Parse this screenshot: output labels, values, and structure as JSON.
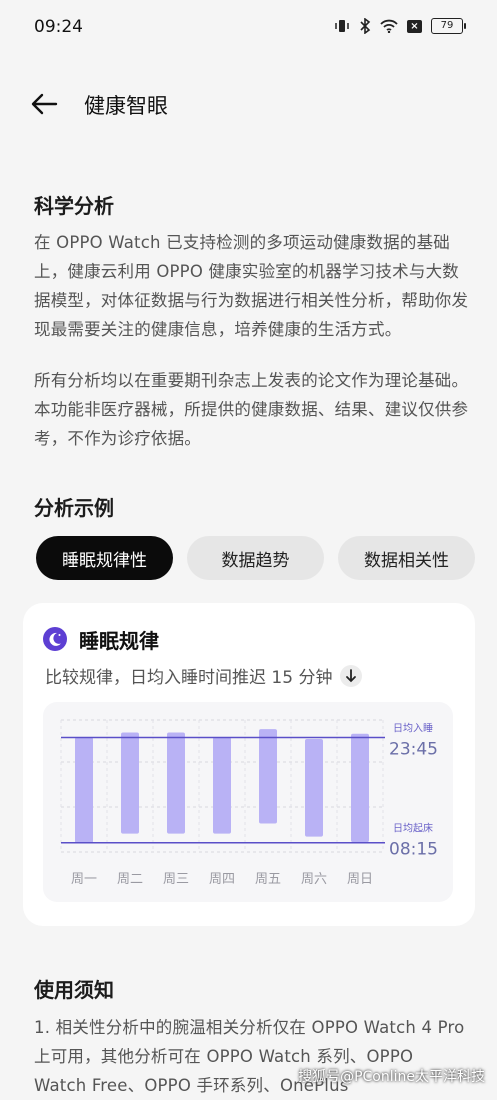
{
  "status_bar": {
    "time": "09:24",
    "battery": "79",
    "icons": [
      "vibrate-icon",
      "bluetooth-icon",
      "wifi-icon",
      "sim-x-icon",
      "battery-icon"
    ]
  },
  "header": {
    "title": "健康智眼",
    "back_icon": "arrow-left-icon"
  },
  "science": {
    "title": "科学分析",
    "p1": "在 OPPO Watch 已支持检测的多项运动健康数据的基础上，健康云利用 OPPO 健康实验室的机器学习技术与大数据模型，对体征数据与行为数据进行相关性分析，帮助你发现最需要关注的健康信息，培养健康的生活方式。",
    "p2": "所有分析均以在重要期刊杂志上发表的论文作为理论基础。本功能非医疗器械，所提供的健康数据、结果、建议仅供参考，不作为诊疗依据。"
  },
  "examples": {
    "title": "分析示例",
    "tabs": [
      "睡眠规律性",
      "数据趋势",
      "数据相关性"
    ],
    "active_tab": "睡眠规律性"
  },
  "card": {
    "title": "睡眠规律",
    "subtitle": "比较规律，日均入睡时间推迟 15 分钟",
    "icon": "moon-icon",
    "accent": "#5d3fd3"
  },
  "chart_data": {
    "type": "bar",
    "categories": [
      "周一",
      "周二",
      "周三",
      "周四",
      "周五",
      "周六",
      "周日"
    ],
    "bar_color": "#b9b2f5",
    "line_color": "#5a4fc8",
    "series": [
      {
        "sleep": 23.72,
        "wake": 8.28
      },
      {
        "sleep": 23.35,
        "wake": 7.52
      },
      {
        "sleep": 23.35,
        "wake": 7.52
      },
      {
        "sleep": 23.72,
        "wake": 7.52
      },
      {
        "sleep": 23.08,
        "wake": 6.7
      },
      {
        "sleep": 23.87,
        "wake": 7.76
      },
      {
        "sleep": 23.45,
        "wake": 8.2
      }
    ],
    "annotations": {
      "sleep_label": "日均入睡",
      "sleep_time": "23:45",
      "sleep_value": 23.75,
      "wake_label": "日均起床",
      "wake_time": "08:15",
      "wake_value": 8.25
    }
  },
  "notice": {
    "title": "使用须知",
    "p1": "1. 相关性分析中的腕温相关分析仅在 OPPO Watch 4 Pro 上可用，其他分析可在 OPPO Watch 系列、OPPO Watch Free、OPPO 手环系列、OnePlus"
  },
  "watermark": "搜狐号@PConline太平洋科技"
}
